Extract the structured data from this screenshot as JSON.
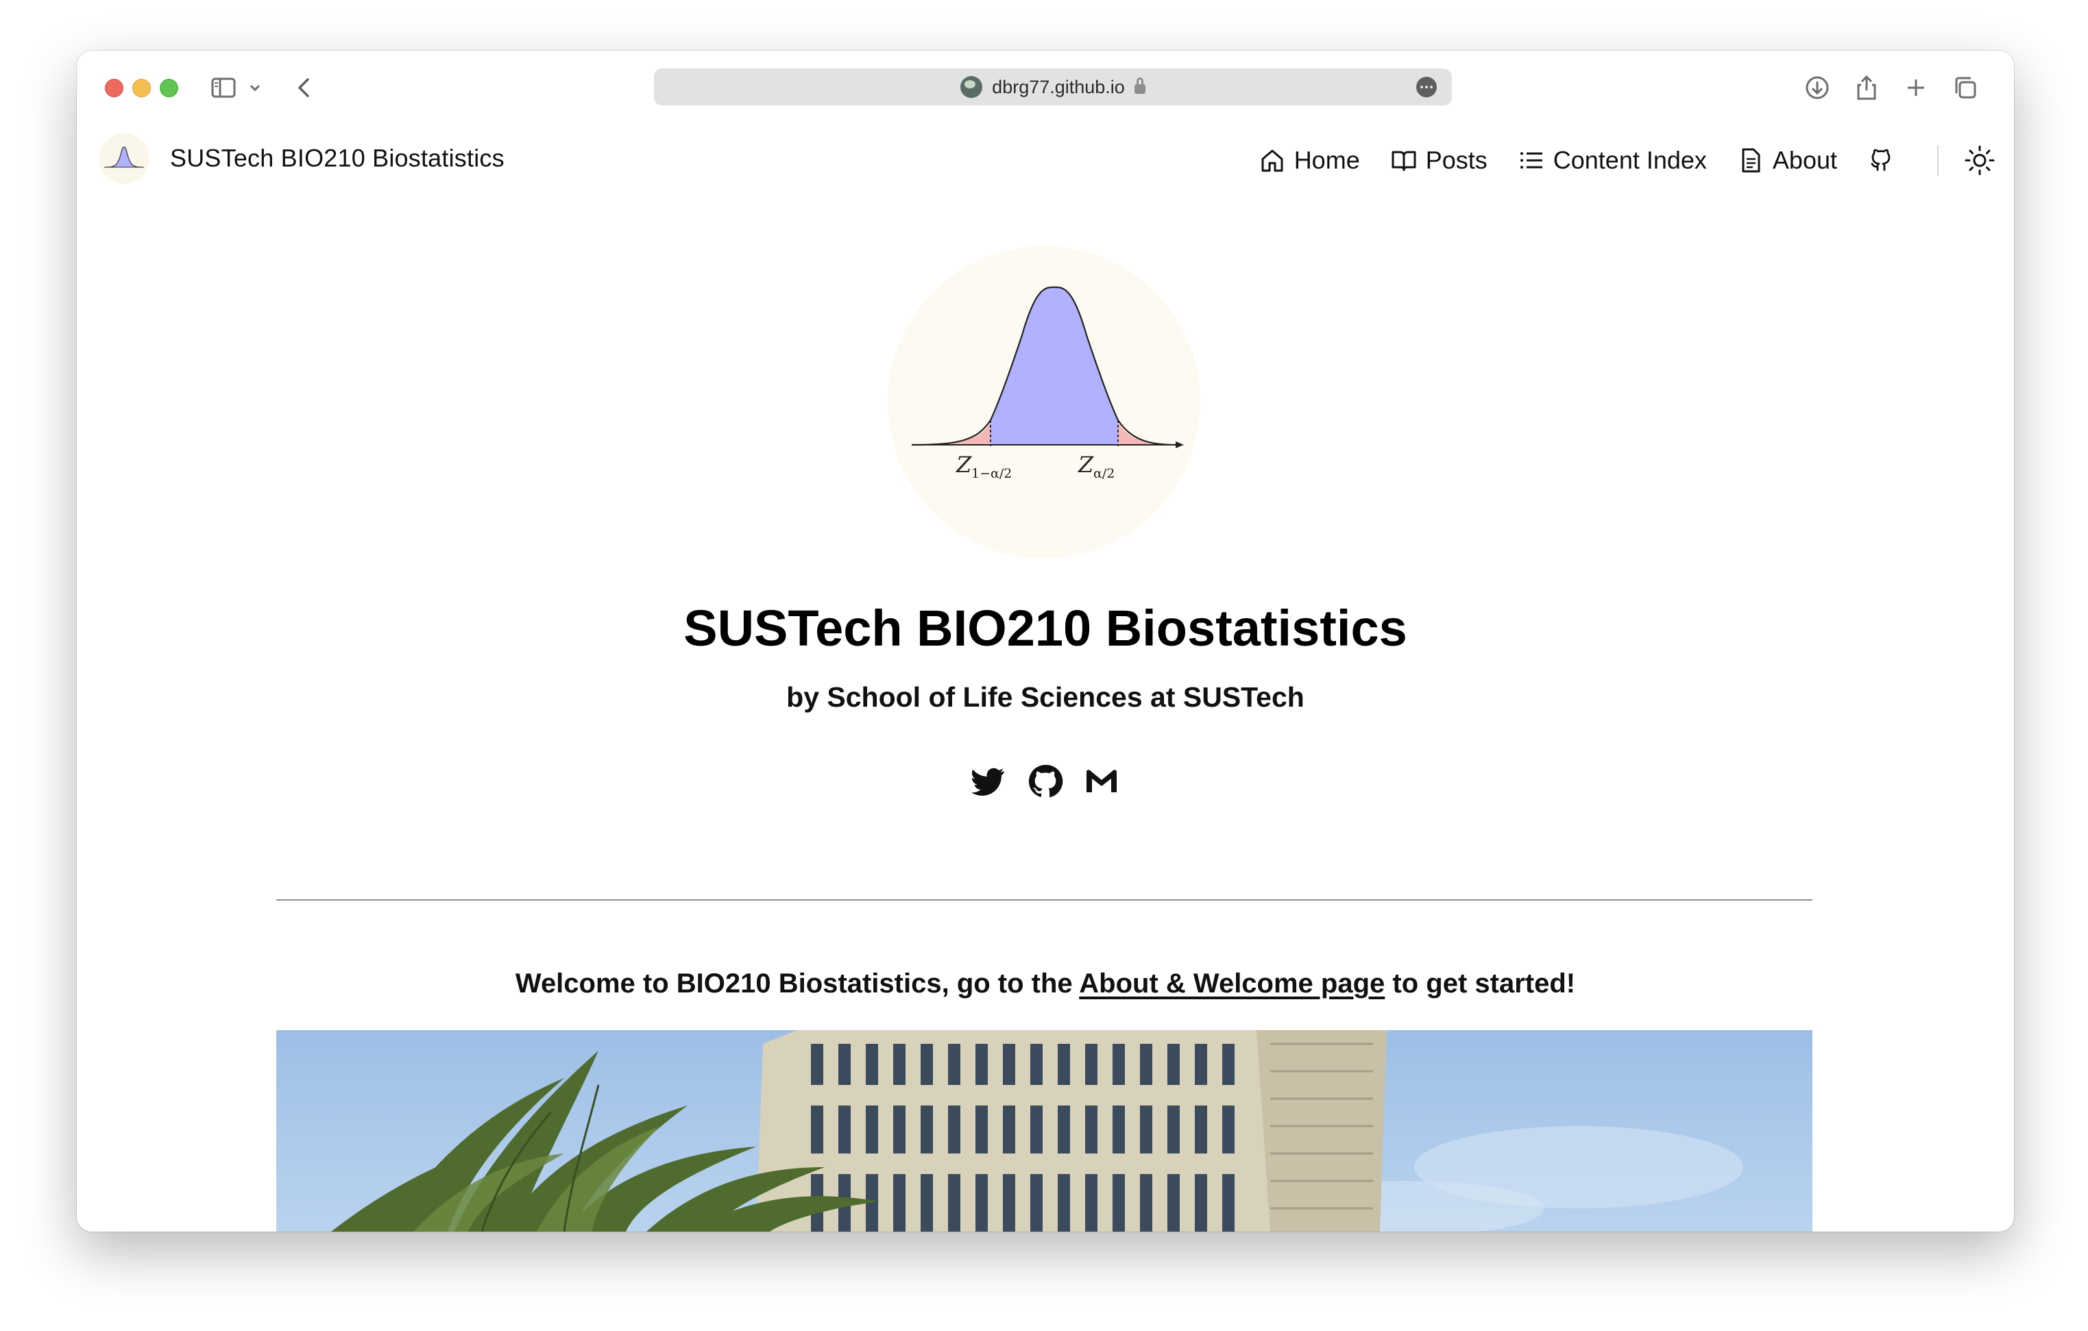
{
  "browser": {
    "url": "dbrg77.github.io"
  },
  "site": {
    "title": "SUSTech BIO210 Biostatistics",
    "nav": {
      "home": "Home",
      "posts": "Posts",
      "content_index": "Content Index",
      "about": "About"
    }
  },
  "hero": {
    "figure_label_left": "Z",
    "figure_sub_left": "1−α/2",
    "figure_label_right": "Z",
    "figure_sub_right": "α/2",
    "title": "SUSTech BIO210 Biostatistics",
    "subtitle": "by School of Life Sciences at SUSTech",
    "socials": [
      "twitter-icon",
      "github-icon",
      "gmail-icon"
    ]
  },
  "welcome": {
    "prefix": "Welcome to BIO210 Biostatistics, go to the ",
    "link": "About & Welcome page",
    "suffix": " to get started!"
  },
  "colors": {
    "curve_fill": "#b0b2ff",
    "tail_fill": "#f5b8b8",
    "avatar_bg": "#fdfbf1",
    "sky": "#a9c8ea"
  }
}
